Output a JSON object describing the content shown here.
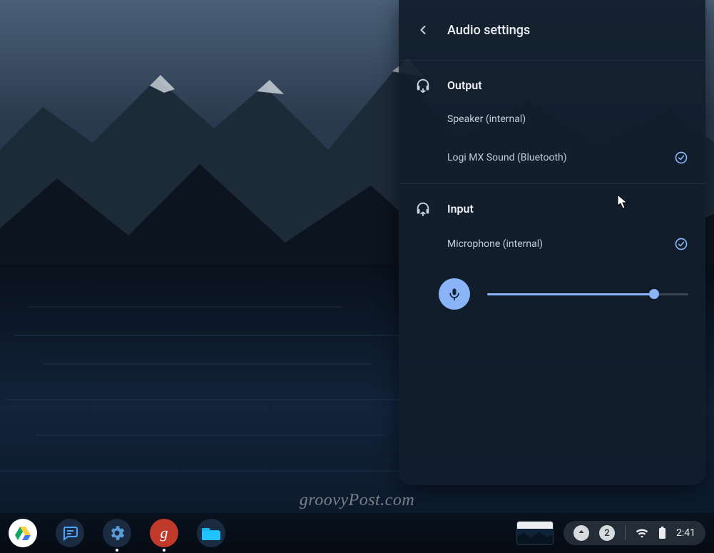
{
  "panel": {
    "title": "Audio settings",
    "output": {
      "heading": "Output",
      "devices": [
        {
          "label": "Speaker (internal)",
          "selected": false
        },
        {
          "label": "Logi MX Sound (Bluetooth)",
          "selected": true
        }
      ]
    },
    "input": {
      "heading": "Input",
      "devices": [
        {
          "label": "Microphone (internal)",
          "selected": true
        }
      ],
      "mic_level_percent": 83
    }
  },
  "shelf": {
    "apps": [
      {
        "name": "drive",
        "icon": "drive-icon"
      },
      {
        "name": "messages",
        "icon": "messages-icon"
      },
      {
        "name": "settings",
        "icon": "gear-icon"
      },
      {
        "name": "groovypost",
        "icon": "g-icon"
      },
      {
        "name": "files",
        "icon": "folder-icon"
      }
    ],
    "status": {
      "notification_count": "2",
      "time": "2:41"
    }
  },
  "watermark": "groovyPost.com"
}
